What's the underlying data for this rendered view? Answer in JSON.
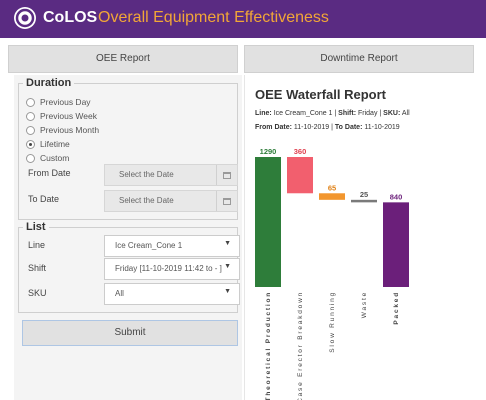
{
  "header": {
    "brand": "CoLOS",
    "title": "Overall Equipment Effectiveness"
  },
  "tabs": {
    "oee": "OEE Report",
    "downtime": "Downtime Report"
  },
  "duration": {
    "legend": "Duration",
    "options": [
      "Previous Day",
      "Previous Week",
      "Previous Month",
      "Lifetime",
      "Custom"
    ],
    "selected": "Lifetime",
    "from_label": "From Date",
    "to_label": "To Date",
    "from_placeholder": "Select the Date",
    "to_placeholder": "Select the Date"
  },
  "list": {
    "legend": "List",
    "line_label": "Line",
    "line_value": "Ice Cream_Cone 1",
    "shift_label": "Shift",
    "shift_value": "Friday [11-10-2019 11:42 to - ]",
    "sku_label": "SKU",
    "sku_value": "All"
  },
  "submit_label": "Submit",
  "report": {
    "title": "OEE Waterfall Report",
    "line_key": "Line:",
    "line_val": "Ice Cream_Cone 1 |",
    "shift_key": "Shift:",
    "shift_val": "Friday |",
    "sku_key": "SKU:",
    "sku_val": "All",
    "from_key": "From Date:",
    "from_val": "11-10-2019 |",
    "to_key": "To Date:",
    "to_val": "11-10-2019"
  },
  "colors": {
    "header": "#5a2b82",
    "header_accent": "#f2a637",
    "theoretical": "#2e7d3a",
    "breakdown": "#f25f6e",
    "slow": "#f2962e",
    "waste": "#7a7a7a",
    "packed": "#6b1f7a"
  },
  "chart_data": {
    "type": "bar",
    "subtype": "waterfall",
    "categories": [
      "Theoretical Production",
      "Case Erector Breakdown",
      "Slow Running",
      "Waste",
      "Packed"
    ],
    "values": [
      1290,
      360,
      65,
      25,
      840
    ],
    "bases": [
      0,
      930,
      865,
      840,
      0
    ],
    "labels": [
      "1290",
      "360",
      "65",
      "25",
      "840"
    ],
    "label_colors": [
      "#2e7d3a",
      "#e0404f",
      "#e07f12",
      "#555555",
      "#6b1f7a"
    ],
    "bar_colors": [
      "#2e7d3a",
      "#f25f6e",
      "#f2962e",
      "#7a7a7a",
      "#6b1f7a"
    ],
    "bold_categories": [
      true,
      false,
      false,
      false,
      true
    ],
    "ylim": [
      0,
      1290
    ],
    "grid": false
  }
}
